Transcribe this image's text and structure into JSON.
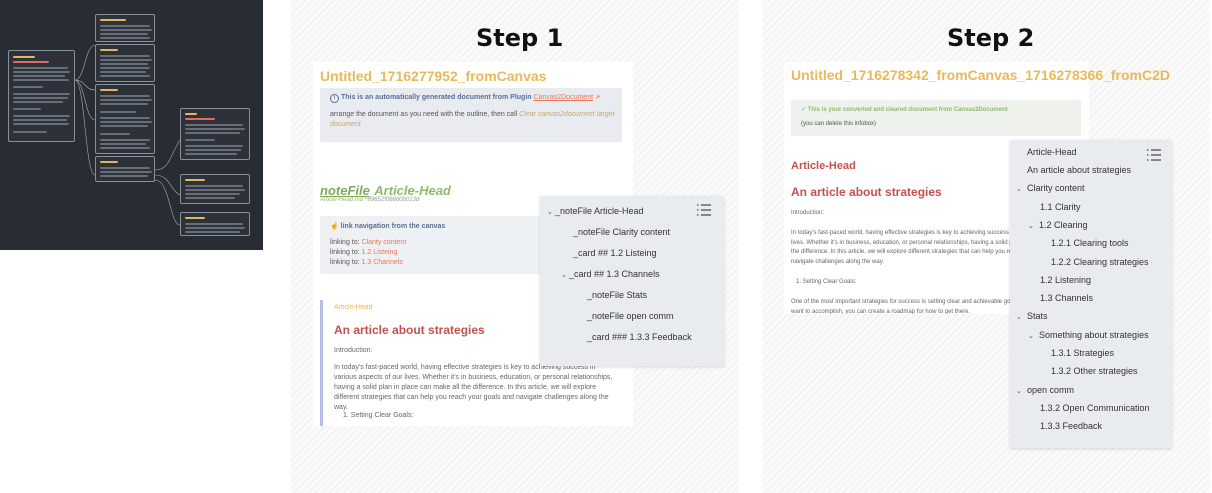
{
  "steps": {
    "step1_label": "Step 1",
    "step2_label": "Step 2"
  },
  "doc1": {
    "title": "Untitled_1716277952_fromCanvas",
    "info_text": "This is an automatically generated document from Plugin",
    "info_link": "Canvas2Document",
    "arrange_text": "arrange the document as you need with the outline, then call",
    "arrange_link": "Clear canvas2document target document",
    "notefile_tag": "noteFile",
    "notefile_title": "Article-Head",
    "notefile_path": "Article-Head.md",
    "notefile_hash": "^89652f068d0b013d",
    "linknav_title": "link navigation from the canvas",
    "linking_prefix": "linking to:",
    "links": [
      "Clarity content",
      "1.2 Listeing",
      "1.3 Channels"
    ],
    "block_label": "Article-Head",
    "block_title": "An article about strategies",
    "intro": "Introduction:",
    "para": "In today's fast-paced world, having effective strategies is key to achieving success in various aspects of our lives. Whether it's in business, education, or personal relationships, having a solid plan in place can make all the difference. In this article, we will explore different strategies that can help you reach your goals and navigate challenges along the way.",
    "list1": "1.  Setting Clear Goals:"
  },
  "outline1": {
    "items": [
      {
        "text": "_noteFile Article-Head",
        "chevron": "v"
      },
      {
        "text": "_noteFile Clarity content",
        "chevron": ""
      },
      {
        "text": "_card ## 1.2 Listeing",
        "chevron": ""
      },
      {
        "text": "_card ## 1.3 Channels",
        "chevron": "v"
      },
      {
        "text": "_noteFile Stats",
        "chevron": ""
      },
      {
        "text": "_noteFile open comm",
        "chevron": ""
      },
      {
        "text": "_card ### 1.3.3 Feedback",
        "chevron": ""
      }
    ]
  },
  "doc2": {
    "title": "Untitled_1716278342_fromCanvas_1716278366_fromC2D",
    "info_text": "This is your converted and cleared document from Canvas2Document",
    "info_sub": "(you can delete this infobox)",
    "article_head": "Article-Head",
    "block_title": "An article about strategies",
    "intro": "Introduction:",
    "para": "In today's fast-paced world, having effective strategies is key to achieving success in various aspects of our lives. Whether it's in business, education, or personal relationships, having a solid plan in place can make all the difference. In this article, we will explore different strategies that can help you reach your goals and navigate challenges along the way.",
    "list1": "1.  Setting Clear Goals:",
    "para2": "One of the most important strategies for success is setting clear and achievable goals. By defining what you want to accomplish, you can create a roadmap for how to get there."
  },
  "outline2": {
    "items": [
      {
        "text": "Article-Head",
        "chevron": ""
      },
      {
        "text": "An article about strategies",
        "chevron": ""
      },
      {
        "text": "Clarity content",
        "chevron": "v"
      },
      {
        "text": "1.1 Clarity",
        "chevron": ""
      },
      {
        "text": "1.2 Clearing",
        "chevron": "v"
      },
      {
        "text": "1.2.1 Clearing tools",
        "chevron": ""
      },
      {
        "text": "1.2.2 Clearing strategies",
        "chevron": ""
      },
      {
        "text": "1.2 Listening",
        "chevron": ""
      },
      {
        "text": "1.3 Channels",
        "chevron": ""
      },
      {
        "text": "Stats",
        "chevron": "v"
      },
      {
        "text": "Something about strategies",
        "chevron": "v"
      },
      {
        "text": "1.3.1 Strategies",
        "chevron": ""
      },
      {
        "text": "1.3.2 Other strategies",
        "chevron": ""
      },
      {
        "text": "open comm",
        "chevron": "v"
      },
      {
        "text": "1.3.2 Open Communication",
        "chevron": ""
      },
      {
        "text": "1.3.3 Feedback",
        "chevron": ""
      }
    ]
  },
  "canvas": {
    "nodes": [
      "Article-Head",
      "Clarity content",
      "1.2 Clearing",
      "1.2 Listening",
      "1.3 Channels",
      "Stats",
      "open comm",
      "1.3.3 Feedback"
    ]
  },
  "icons": {
    "outline_icon": "list-outline-icon",
    "info_icon": "info-circle-icon",
    "link_icon": "hand-pointer-icon",
    "check_icon": "check-icon",
    "external_icon": "external-link-icon",
    "chevron_icon": "chevron-down-icon"
  },
  "colors": {
    "title_gold": "#e7b95b",
    "heading_red": "#c45050",
    "link_orange": "#e5785b",
    "info_blue": "#5a6f93",
    "check_green": "#8fbc6a",
    "canvas_bg": "#282c34"
  }
}
